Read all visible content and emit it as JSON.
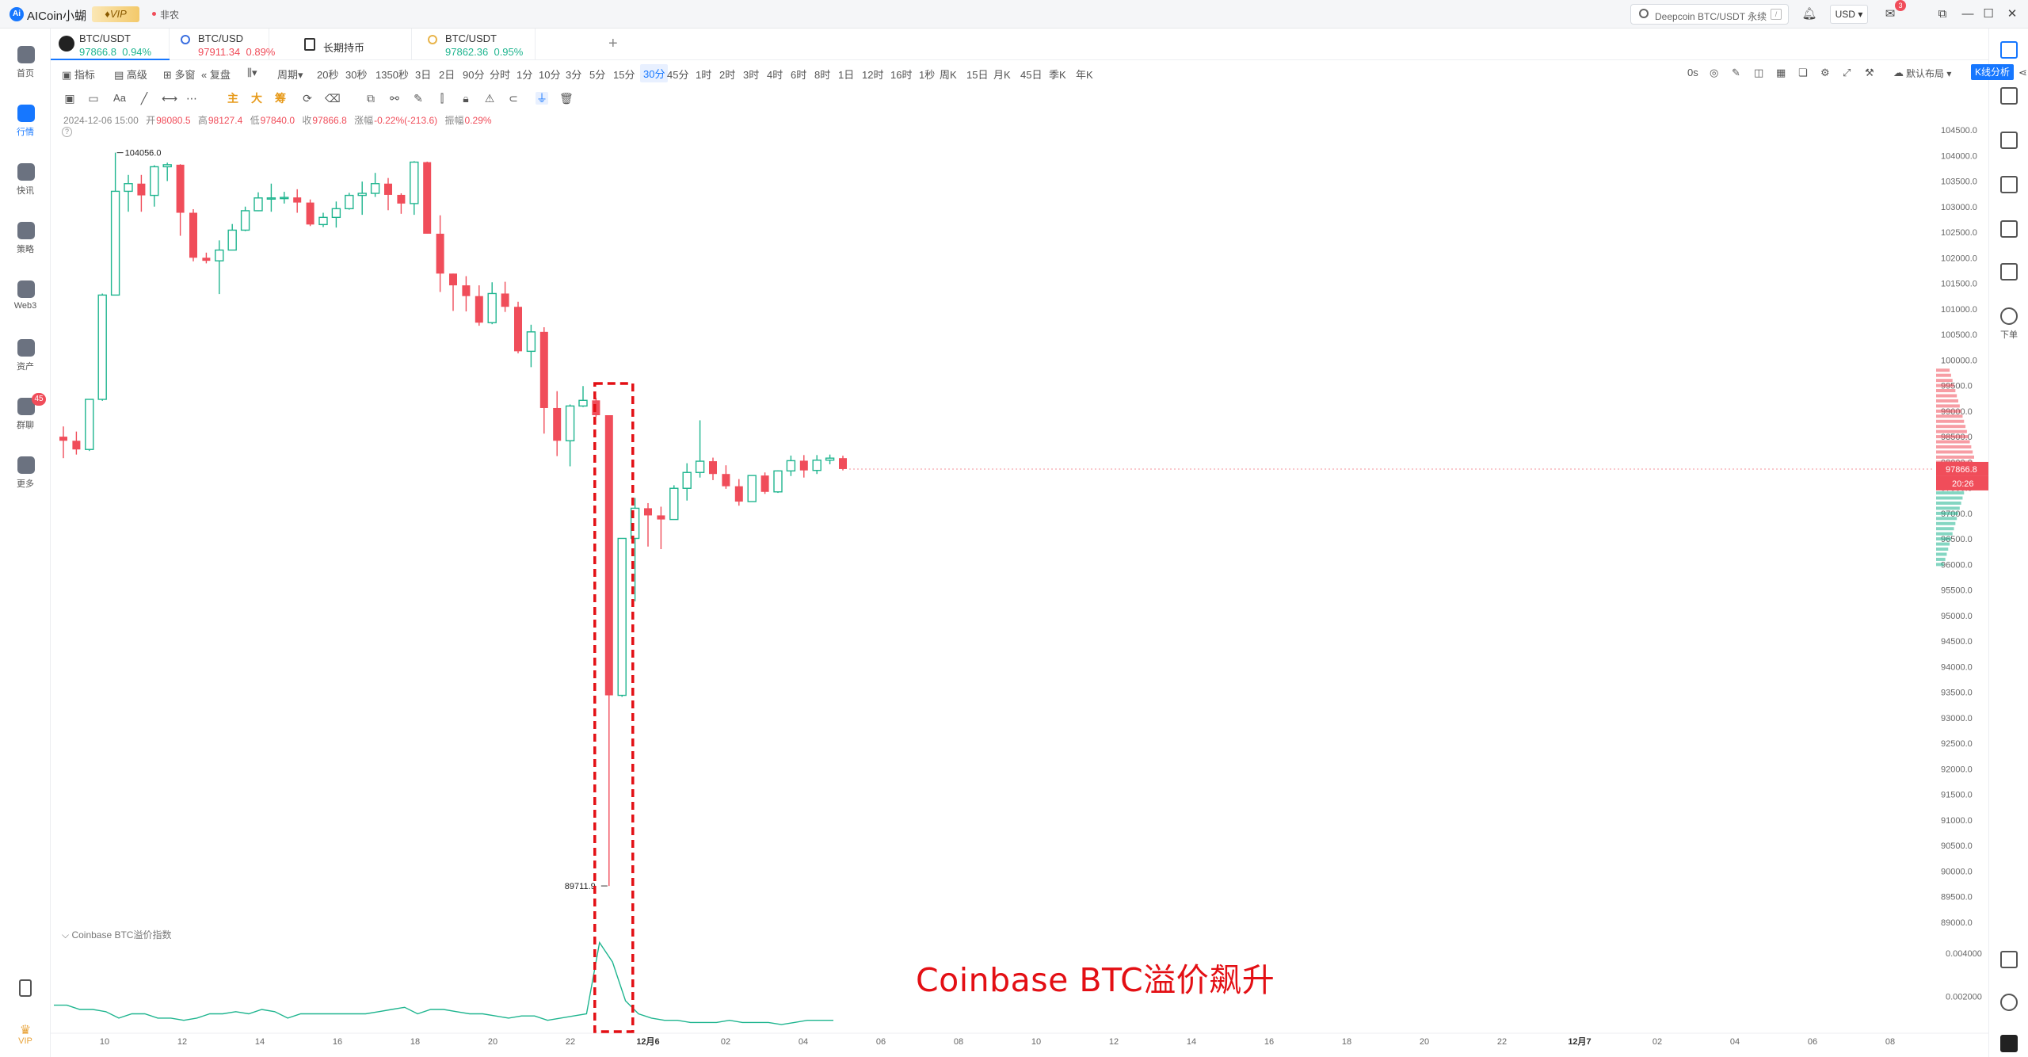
{
  "app": {
    "title": "AICoin小蝴",
    "vip": "VIP",
    "news_badge": "非农",
    "logo": "Ai"
  },
  "search": {
    "placeholder": "Deepcoin BTC/USDT 永续",
    "shortcut": "/"
  },
  "header": {
    "currency": "USD",
    "notification_count": "3"
  },
  "left_nav": [
    {
      "label": "首页",
      "icon": "home-icon"
    },
    {
      "label": "行情",
      "icon": "market-chart-icon",
      "active": true
    },
    {
      "label": "快讯",
      "icon": "news-icon"
    },
    {
      "label": "策略",
      "icon": "robot-icon"
    },
    {
      "label": "Web3",
      "icon": "web3-icon"
    },
    {
      "label": "资产",
      "icon": "wallet-icon"
    },
    {
      "label": "群聊",
      "icon": "chat-icon",
      "badge": "45"
    },
    {
      "label": "更多",
      "icon": "more-grid-icon"
    }
  ],
  "left_nav_bottom": {
    "vip_label": "VIP"
  },
  "right_nav": {
    "order_label": "下单"
  },
  "tabs": [
    {
      "name": "BTC/USDT",
      "price": "97866.8",
      "change": "0.94%",
      "dir": "up",
      "active": true
    },
    {
      "name": "BTC/USD",
      "price": "97911.34",
      "change": "0.89%",
      "dir": "down"
    },
    {
      "name": "长期持币",
      "price": "",
      "change": "",
      "dir": ""
    },
    {
      "name": "BTC/USDT",
      "price": "97862.36",
      "change": "0.95%",
      "dir": "up"
    }
  ],
  "toolbar": {
    "indicators": "指标",
    "advanced": "高级",
    "multi_chart": "多窗",
    "replay": "复盘",
    "period": "周期",
    "periods": [
      "20秒",
      "30秒",
      "1350秒",
      "3日",
      "2日",
      "90分",
      "分时",
      "1分",
      "10分",
      "3分",
      "5分",
      "15分",
      "30分",
      "45分",
      "1时",
      "2时",
      "3时",
      "4时",
      "6时",
      "8时",
      "1日",
      "12时",
      "16时",
      "1秒",
      "周K",
      "15日",
      "月K",
      "45日",
      "季K",
      "年K"
    ],
    "active_period": "30分",
    "countdown": "0s",
    "layout": "默认布局",
    "kline_analysis": "K线分析"
  },
  "draw_tools": {
    "text_tool": "Aa",
    "main": "主",
    "big": "大",
    "chip": "筹"
  },
  "ohlc": {
    "datetime": "2024-12-06 15:00",
    "open_label": "开",
    "open": "98080.5",
    "high_label": "高",
    "high": "98127.4",
    "low_label": "低",
    "low": "97840.0",
    "close_label": "收",
    "close": "97866.8",
    "change_label": "涨幅",
    "change": "-0.22%(-213.6)",
    "amp_label": "振幅",
    "amp": "0.29%"
  },
  "price_axis": {
    "ticks": [
      "104500.0",
      "104000.0",
      "103500.0",
      "103000.0",
      "102500.0",
      "102000.0",
      "101500.0",
      "101000.0",
      "100500.0",
      "100000.0",
      "99500.0",
      "99000.0",
      "98500.0",
      "98000.0",
      "97500.0",
      "97000.0",
      "96500.0",
      "96000.0",
      "95500.0",
      "95000.0",
      "94500.0",
      "94000.0",
      "93500.0",
      "93000.0",
      "92500.0",
      "92000.0",
      "91500.0",
      "91000.0",
      "90500.0",
      "90000.0",
      "89500.0",
      "89000.0"
    ],
    "current_price": "97866.8",
    "countdown": "20:26"
  },
  "time_axis": {
    "ticks": [
      "10",
      "12",
      "14",
      "16",
      "18",
      "20",
      "22",
      "12月6",
      "02",
      "04",
      "06",
      "08",
      "10",
      "12",
      "14",
      "16",
      "18",
      "20",
      "22",
      "12月7",
      "02",
      "04",
      "06",
      "08"
    ]
  },
  "indicator": {
    "title": "Coinbase BTC溢价指数",
    "ticks": [
      "0.004000",
      "0.002000"
    ]
  },
  "annotation": "Coinbase BTC溢价飙升",
  "colors": {
    "up": "#1fb58f",
    "down": "#f04d5a",
    "accent": "#1677ff",
    "annotation": "#e30f14"
  },
  "chart_data": {
    "type": "candlestick",
    "title": "BTC/USDT 30分",
    "ylim": [
      88700,
      104700
    ],
    "max_label": "104056.0",
    "min_label": "89711.9",
    "candles": [
      {
        "t": "12-05 08:00",
        "o": 98500,
        "h": 98700,
        "l": 98080,
        "c": 98420
      },
      {
        "t": "12-05 08:30",
        "o": 98420,
        "h": 98600,
        "l": 98150,
        "c": 98250
      },
      {
        "t": "12-05 09:00",
        "o": 98250,
        "h": 99230,
        "l": 98220,
        "c": 99230
      },
      {
        "t": "12-05 09:30",
        "o": 99230,
        "h": 101300,
        "l": 99200,
        "c": 101270
      },
      {
        "t": "12-05 10:00",
        "o": 101270,
        "h": 104056,
        "l": 101270,
        "c": 103300
      },
      {
        "t": "12-05 10:30",
        "o": 103300,
        "h": 103620,
        "l": 102900,
        "c": 103450
      },
      {
        "t": "12-05 11:00",
        "o": 103450,
        "h": 103620,
        "l": 102900,
        "c": 103220
      },
      {
        "t": "12-05 11:30",
        "o": 103220,
        "h": 103810,
        "l": 103000,
        "c": 103780
      },
      {
        "t": "12-05 12:00",
        "o": 103780,
        "h": 103860,
        "l": 103500,
        "c": 103820
      },
      {
        "t": "12-05 12:30",
        "o": 103820,
        "h": 103830,
        "l": 102430,
        "c": 102880
      },
      {
        "t": "12-05 13:00",
        "o": 102880,
        "h": 102950,
        "l": 101930,
        "c": 102000
      },
      {
        "t": "12-05 13:30",
        "o": 102000,
        "h": 102100,
        "l": 101890,
        "c": 101940
      },
      {
        "t": "12-05 14:00",
        "o": 101940,
        "h": 102340,
        "l": 101290,
        "c": 102150
      },
      {
        "t": "12-05 14:30",
        "o": 102150,
        "h": 102660,
        "l": 102150,
        "c": 102540
      },
      {
        "t": "12-05 15:00",
        "o": 102540,
        "h": 103000,
        "l": 102520,
        "c": 102920
      },
      {
        "t": "12-05 15:30",
        "o": 102920,
        "h": 103280,
        "l": 102910,
        "c": 103170
      },
      {
        "t": "12-05 16:00",
        "o": 103170,
        "h": 103450,
        "l": 102900,
        "c": 103170
      },
      {
        "t": "12-05 16:30",
        "o": 103170,
        "h": 103290,
        "l": 103060,
        "c": 103180
      },
      {
        "t": "12-05 17:00",
        "o": 103180,
        "h": 103340,
        "l": 102880,
        "c": 103080
      },
      {
        "t": "12-05 17:30",
        "o": 103080,
        "h": 103140,
        "l": 102620,
        "c": 102650
      },
      {
        "t": "12-05 18:00",
        "o": 102650,
        "h": 102880,
        "l": 102600,
        "c": 102790
      },
      {
        "t": "12-05 18:30",
        "o": 102790,
        "h": 103100,
        "l": 102590,
        "c": 102960
      },
      {
        "t": "12-05 19:00",
        "o": 102960,
        "h": 103270,
        "l": 102940,
        "c": 103220
      },
      {
        "t": "12-05 19:30",
        "o": 103220,
        "h": 103490,
        "l": 102840,
        "c": 103260
      },
      {
        "t": "12-05 20:00",
        "o": 103260,
        "h": 103660,
        "l": 103190,
        "c": 103450
      },
      {
        "t": "12-05 20:30",
        "o": 103450,
        "h": 103560,
        "l": 102930,
        "c": 103230
      },
      {
        "t": "12-05 21:00",
        "o": 103230,
        "h": 103260,
        "l": 102860,
        "c": 103060
      },
      {
        "t": "12-05 21:30",
        "o": 103060,
        "h": 103890,
        "l": 102840,
        "c": 103870
      },
      {
        "t": "12-05 22:00",
        "o": 103870,
        "h": 103880,
        "l": 102470,
        "c": 102470
      },
      {
        "t": "12-05 22:30",
        "o": 102470,
        "h": 102830,
        "l": 101330,
        "c": 101690
      },
      {
        "t": "12-05 23:00",
        "o": 101690,
        "h": 101690,
        "l": 100960,
        "c": 101460
      },
      {
        "t": "12-05 23:30",
        "o": 101460,
        "h": 101640,
        "l": 100950,
        "c": 101250
      },
      {
        "t": "12-06 00:00",
        "o": 101250,
        "h": 101460,
        "l": 100670,
        "c": 100730
      },
      {
        "t": "12-06 00:30",
        "o": 100730,
        "h": 101520,
        "l": 100700,
        "c": 101300
      },
      {
        "t": "12-06 01:00",
        "o": 101300,
        "h": 101530,
        "l": 100940,
        "c": 101040
      },
      {
        "t": "12-06 01:30",
        "o": 101040,
        "h": 101140,
        "l": 100130,
        "c": 100170
      },
      {
        "t": "12-06 02:00",
        "o": 100170,
        "h": 100690,
        "l": 99860,
        "c": 100550
      },
      {
        "t": "12-06 02:30",
        "o": 100550,
        "h": 100640,
        "l": 98560,
        "c": 99060
      },
      {
        "t": "12-06 03:00",
        "o": 99060,
        "h": 99390,
        "l": 98120,
        "c": 98420
      },
      {
        "t": "12-06 03:30",
        "o": 98420,
        "h": 99130,
        "l": 97920,
        "c": 99100
      },
      {
        "t": "12-06 04:00",
        "o": 99100,
        "h": 99490,
        "l": 99080,
        "c": 99210
      },
      {
        "t": "12-06 04:30",
        "o": 99210,
        "h": 99260,
        "l": 98890,
        "c": 98920
      },
      {
        "t": "12-06 05:00",
        "o": 98920,
        "h": 98920,
        "l": 89711.9,
        "c": 93440
      },
      {
        "t": "12-06 05:30",
        "o": 93440,
        "h": 96510,
        "l": 93410,
        "c": 96510
      },
      {
        "t": "12-06 06:00",
        "o": 96510,
        "h": 97300,
        "l": 95280,
        "c": 97100
      },
      {
        "t": "12-06 06:30",
        "o": 97100,
        "h": 97200,
        "l": 96350,
        "c": 96960
      },
      {
        "t": "12-06 07:00",
        "o": 96960,
        "h": 97130,
        "l": 96300,
        "c": 96880
      },
      {
        "t": "12-06 07:30",
        "o": 96880,
        "h": 97550,
        "l": 96880,
        "c": 97490
      },
      {
        "t": "12-06 08:00",
        "o": 97490,
        "h": 97980,
        "l": 97250,
        "c": 97800
      },
      {
        "t": "12-06 08:30",
        "o": 97800,
        "h": 98820,
        "l": 97700,
        "c": 98020
      },
      {
        "t": "12-06 09:00",
        "o": 98020,
        "h": 98090,
        "l": 97650,
        "c": 97770
      },
      {
        "t": "12-06 09:30",
        "o": 97770,
        "h": 97940,
        "l": 97480,
        "c": 97530
      },
      {
        "t": "12-06 10:00",
        "o": 97530,
        "h": 97670,
        "l": 97150,
        "c": 97230
      },
      {
        "t": "12-06 10:30",
        "o": 97230,
        "h": 97750,
        "l": 97230,
        "c": 97740
      },
      {
        "t": "12-06 11:00",
        "o": 97740,
        "h": 97800,
        "l": 97380,
        "c": 97420
      },
      {
        "t": "12-06 11:30",
        "o": 97420,
        "h": 97840,
        "l": 97400,
        "c": 97830
      },
      {
        "t": "12-06 12:00",
        "o": 97830,
        "h": 98130,
        "l": 97730,
        "c": 98030
      },
      {
        "t": "12-06 12:30",
        "o": 98030,
        "h": 98140,
        "l": 97700,
        "c": 97840
      },
      {
        "t": "12-06 13:00",
        "o": 97840,
        "h": 98140,
        "l": 97770,
        "c": 98040
      },
      {
        "t": "12-06 13:30",
        "o": 98040,
        "h": 98150,
        "l": 97960,
        "c": 98080
      },
      {
        "t": "12-06 14:00",
        "o": 98080,
        "h": 98127.4,
        "l": 97840,
        "c": 97866.8
      }
    ],
    "premium_index": [
      0.0016,
      0.0016,
      0.0014,
      0.0014,
      0.0013,
      0.001,
      0.0012,
      0.0012,
      0.001,
      0.001,
      0.0009,
      0.001,
      0.0012,
      0.0012,
      0.0013,
      0.0012,
      0.0014,
      0.0013,
      0.001,
      0.0012,
      0.0012,
      0.0012,
      0.0012,
      0.0012,
      0.0012,
      0.0013,
      0.0014,
      0.0015,
      0.0012,
      0.0014,
      0.0014,
      0.0013,
      0.0012,
      0.0012,
      0.0011,
      0.001,
      0.0011,
      0.0011,
      0.0009,
      0.001,
      0.0011,
      0.0012,
      0.0045,
      0.0036,
      0.0018,
      0.0012,
      0.001,
      0.0009,
      0.0009,
      0.0008,
      0.0008,
      0.0008,
      0.0009,
      0.0008,
      0.0008,
      0.0008,
      0.0007,
      0.0008,
      0.0009,
      0.0009,
      0.0009
    ],
    "premium_ylim": [
      0.0003,
      0.005
    ]
  }
}
